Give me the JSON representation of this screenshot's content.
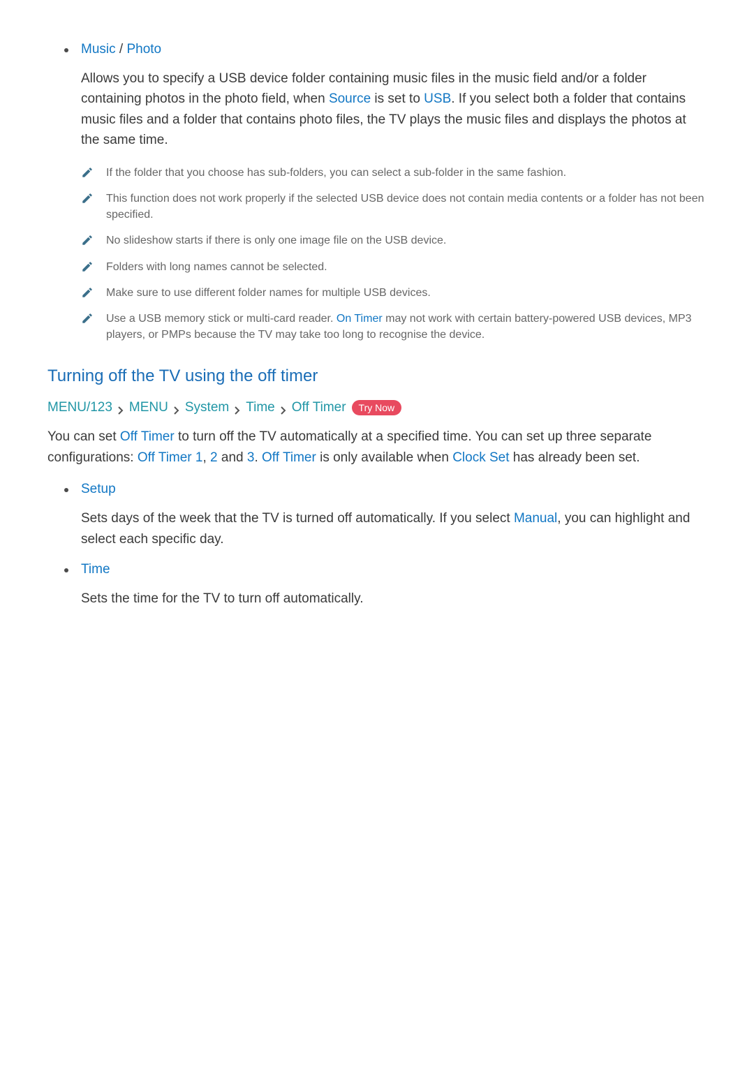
{
  "musicPhoto": {
    "head": {
      "music": "Music",
      "sep": " / ",
      "photo": "Photo"
    },
    "desc": {
      "pre": "Allows you to specify a USB device folder containing music files in the music field and/or a folder containing photos in the photo field, when ",
      "source": "Source",
      "mid1": " is set to ",
      "usb": "USB",
      "post": ". If you select both a folder that contains music files and a folder that contains photo files, the TV plays the music files and displays the photos at the same time."
    },
    "notes": [
      {
        "text": "If the folder that you choose has sub-folders, you can select a sub-folder in the same fashion."
      },
      {
        "text": "This function does not work properly if the selected USB device does not contain media contents or a folder has not been specified."
      },
      {
        "text": "No slideshow starts if there is only one image file on the USB device."
      },
      {
        "text": "Folders with long names cannot be selected."
      },
      {
        "text": "Make sure to use different folder names for multiple USB devices."
      },
      {
        "pre": "Use a USB memory stick or multi-card reader. ",
        "term": "On Timer",
        "post": " may not work with certain battery-powered USB devices, MP3 players, or PMPs because the TV may take too long to recognise the device."
      }
    ]
  },
  "offTimerSection": {
    "heading": "Turning off the TV using the off timer",
    "path": {
      "p1": "MENU/123",
      "p2": "MENU",
      "p3": "System",
      "p4": "Time",
      "p5": "Off Timer",
      "tryNow": "Try Now"
    },
    "desc": {
      "t1": "You can set ",
      "offTimer": "Off Timer",
      "t2": " to turn off the TV automatically at a specified time. You can set up three separate configurations: ",
      "ot1": "Off Timer 1",
      "comma": ", ",
      "ot2": "2",
      "and": " and ",
      "ot3": "3",
      "t3": ". ",
      "offTimer2": "Off Timer",
      "t4": " is only available when ",
      "clockSet": "Clock Set",
      "t5": " has already been set."
    },
    "items": [
      {
        "label": "Setup",
        "desc": {
          "t1": "Sets days of the week that the TV is turned off automatically. If you select ",
          "manual": "Manual",
          "t2": ", you can highlight and select each specific day."
        }
      },
      {
        "label": "Time",
        "desc": {
          "t1": "Sets the time for the TV to turn off automatically."
        }
      }
    ]
  }
}
